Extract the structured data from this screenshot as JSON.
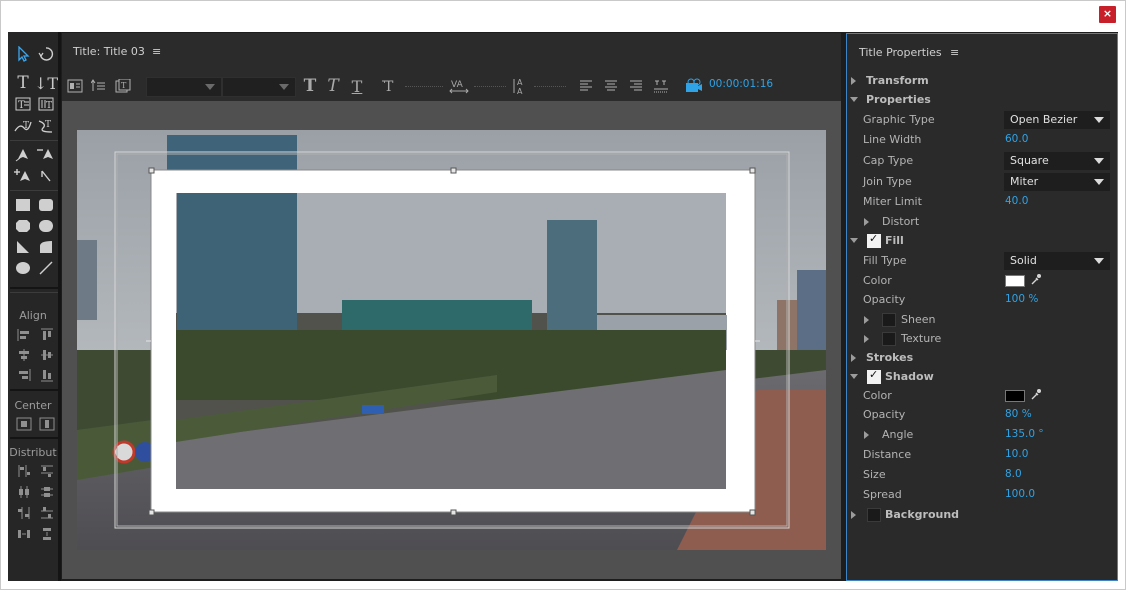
{
  "window": {
    "close_label": "×"
  },
  "tools": {
    "align_label": "Align",
    "center_label": "Center",
    "distribute_label": "Distribut"
  },
  "title_panel": {
    "title": "Title: Title 03",
    "menu_glyph": "≡",
    "timecode": "00:00:01:16"
  },
  "properties": {
    "title": "Title Properties",
    "menu_glyph": "≡",
    "sections": {
      "transform": "Transform",
      "properties": "Properties",
      "fill": "Fill",
      "strokes": "Strokes",
      "shadow": "Shadow",
      "background": "Background"
    },
    "rows": {
      "graphic_type": {
        "label": "Graphic Type",
        "value": "Open Bezier"
      },
      "line_width": {
        "label": "Line Width",
        "value": "60.0"
      },
      "cap_type": {
        "label": "Cap Type",
        "value": "Square"
      },
      "join_type": {
        "label": "Join Type",
        "value": "Miter"
      },
      "miter_limit": {
        "label": "Miter Limit",
        "value": "40.0"
      },
      "distort": {
        "label": "Distort"
      },
      "fill_type": {
        "label": "Fill Type",
        "value": "Solid"
      },
      "fill_color": {
        "label": "Color",
        "color": "#ffffff"
      },
      "fill_opacity": {
        "label": "Opacity",
        "value": "100 %"
      },
      "sheen": {
        "label": "Sheen"
      },
      "texture": {
        "label": "Texture"
      },
      "shadow_color": {
        "label": "Color",
        "color": "#000000"
      },
      "shadow_opacity": {
        "label": "Opacity",
        "value": "80 %"
      },
      "angle": {
        "label": "Angle",
        "value": "135.0 °"
      },
      "distance": {
        "label": "Distance",
        "value": "10.0"
      },
      "size": {
        "label": "Size",
        "value": "8.0"
      },
      "spread": {
        "label": "Spread",
        "value": "100.0"
      }
    }
  },
  "colors": {
    "accent": "#2fa3e6",
    "close": "#c8202b",
    "panel_border": "#3d85c6"
  }
}
